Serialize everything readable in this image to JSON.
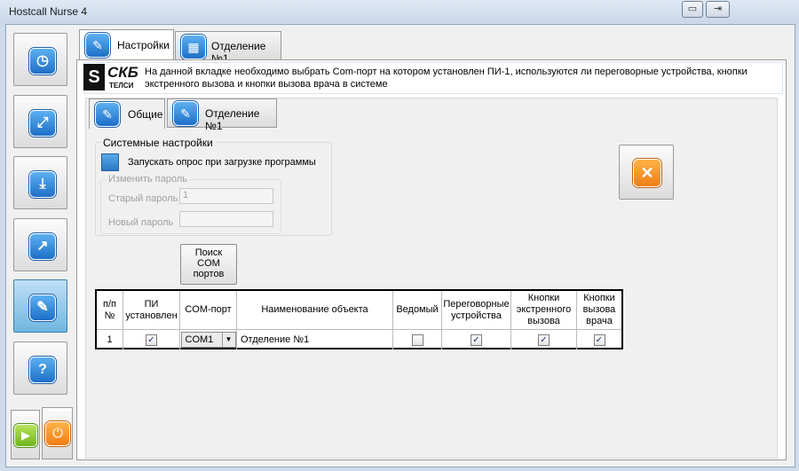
{
  "window": {
    "title": "Hostcall Nurse 4",
    "min_glyph": "▭",
    "max_glyph": "⇥"
  },
  "sidebar": {
    "items": [
      {
        "name": "clock-icon",
        "glyph": "◷"
      },
      {
        "name": "expand-icon",
        "glyph": "⤢"
      },
      {
        "name": "download-icon",
        "glyph": "⤓"
      },
      {
        "name": "chart-icon",
        "glyph": "↗"
      },
      {
        "name": "wrench-icon",
        "glyph": "✎",
        "active": true
      },
      {
        "name": "help-icon",
        "glyph": "?"
      }
    ],
    "start_glyph": "▶",
    "power_glyph": "⏻"
  },
  "tabs": [
    {
      "label": "Настройки",
      "icon": "wrench-icon",
      "glyph": "✎"
    },
    {
      "label": "Отделение №1",
      "icon": "windows-icon",
      "glyph": "▦"
    }
  ],
  "info": {
    "logo_main": "СКБ",
    "logo_sub": "ТЕЛСИ",
    "text": "На данной вкладке необходимо выбрать Com-порт на котором установлен ПИ-1, используются ли переговорные устройства, кнопки экстренного вызова и кнопки вызова врача в системе"
  },
  "subtabs": [
    {
      "label": "Общие",
      "glyph": "✎"
    },
    {
      "label": "Отделение №1",
      "glyph": "✎"
    }
  ],
  "system_settings": {
    "group_label": "Системные настройки",
    "startup_poll_label": "Запускать опрос при загрузке программы",
    "password_group_label": "Изменить пароль",
    "old_password_label": "Старый пароль",
    "old_password_value": "1",
    "new_password_label": "Новый  пароль",
    "new_password_value": ""
  },
  "find_ports_button": {
    "line1": "Поиск",
    "line2": "COM",
    "line3": "портов"
  },
  "close_glyph": "✕",
  "table": {
    "headers": [
      "п/п №",
      "ПИ установлен",
      "COM-порт",
      "Наименование объекта",
      "Ведомый",
      "Переговорные устройства",
      "Кнопки экстренного вызова",
      "Кнопки вызова врача"
    ],
    "rows": [
      {
        "num": "1",
        "pi_installed": true,
        "com_port": "COM1",
        "object_name": "Отделение №1",
        "slave": false,
        "intercoms": true,
        "emergency_buttons": true,
        "doctor_buttons": true
      }
    ]
  }
}
